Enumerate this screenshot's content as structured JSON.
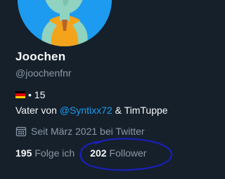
{
  "profile": {
    "display_name": "Joochen",
    "handle": "@joochenfnr",
    "flag_icon": "germany-flag-icon",
    "flag_colors": [
      "#000000",
      "#dd0000",
      "#ffce00"
    ],
    "age_text": "• 15",
    "bio": {
      "prefix": "Vater von ",
      "mention": "@Syntixx72",
      "suffix": " & TimTuppe"
    },
    "joined_icon": "calendar-icon",
    "joined_text": "Seit März 2021 bei Twitter",
    "following_count": "195",
    "following_label": "Folge ich",
    "followers_count": "202",
    "followers_label": "Follower"
  },
  "colors": {
    "background": "#15202b",
    "text_primary": "#f7f9f9",
    "text_secondary": "#8b98a5",
    "link": "#1d9bf0",
    "annotation_ink": "#1a1fb8"
  }
}
